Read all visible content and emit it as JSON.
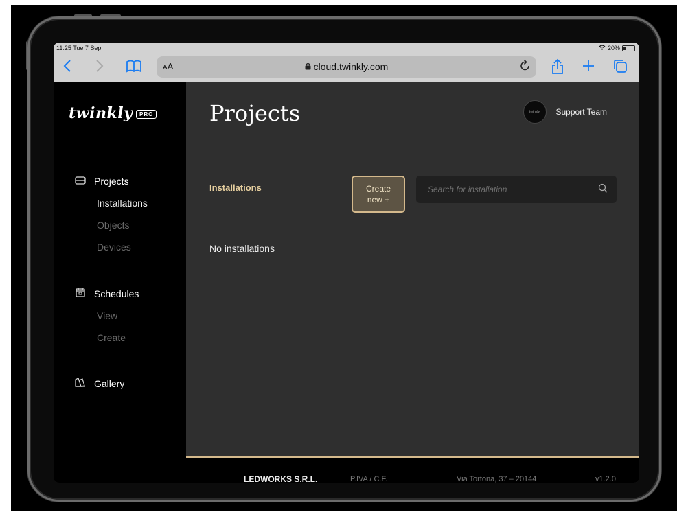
{
  "status": {
    "time": "11:25  Tue 7 Sep",
    "battery": "20%",
    "battery_level": 0.2
  },
  "browser": {
    "aa_label_small": "A",
    "aa_label_big": "A",
    "url": "cloud.twinkly.com"
  },
  "sidebar": {
    "logo_text": "twinkly",
    "logo_badge": "PRO",
    "projects": {
      "label": "Projects",
      "items": [
        "Installations",
        "Objects",
        "Devices"
      ]
    },
    "schedules": {
      "label": "Schedules",
      "items": [
        "View",
        "Create"
      ]
    },
    "gallery": {
      "label": "Gallery"
    }
  },
  "header": {
    "title": "Projects",
    "user_name": "Support Team",
    "avatar_text": "twinkly"
  },
  "main": {
    "section_label": "Installations",
    "create_button_line1": "Create",
    "create_button_line2": "new +",
    "search_placeholder": "Search for installation",
    "empty_text": "No installations"
  },
  "footer": {
    "company": "LEDWORKS S.R.L.",
    "vat": "P.IVA / C.F.",
    "address": "Via Tortona, 37 – 20144",
    "version": "v1.2.0"
  },
  "colors": {
    "accent": "#e6cf9f",
    "button_bg": "#5d5444",
    "button_border": "#d4b98c",
    "sidebar_bg": "#000000",
    "main_bg": "#2f2f2f"
  }
}
